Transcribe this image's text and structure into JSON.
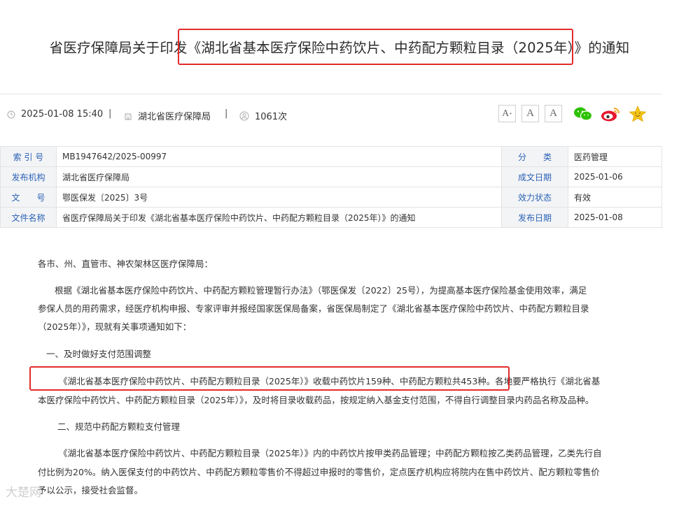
{
  "title": "省医疗保障局关于印发《湖北省基本医疗保险中药饮片、中药配方颗粒目录（2025年）》的通知",
  "meta": {
    "datetime": "2025-01-08 15:40",
    "publisher": "湖北省医疗保障局",
    "views": "1061次",
    "separator": "|"
  },
  "font_buttons": [
    "A+",
    "A",
    "A-"
  ],
  "social_icons": [
    "wechat-icon",
    "weibo-icon",
    "favorite-star-icon"
  ],
  "colors": {
    "label_blue": "#2b62b5",
    "highlight_red": "#e32b2b",
    "wechat": "#2dc100",
    "weibo": "#e6162d",
    "star": "#f5c518"
  },
  "info_table": [
    {
      "l1": "索 引 号",
      "v1": "MB1947642/2025-00997",
      "l2": "分　　类",
      "v2": "医药管理"
    },
    {
      "l1": "发布机构",
      "v1": "湖北省医疗保障局",
      "l2": "成文日期",
      "v2": "2025-01-06"
    },
    {
      "l1": "文　　号",
      "v1": "鄂医保发〔2025〕3号",
      "l2": "效力状态",
      "v2": "有效"
    },
    {
      "l1": "文件名称",
      "v1": "省医疗保障局关于印发《湖北省基本医疗保险中药饮片、中药配方颗粒目录（2025年）》的通知",
      "l2": "发布日期",
      "v2": "2025-01-08"
    }
  ],
  "body": {
    "salutation": "各市、州、直管市、神农架林区医疗保障局：",
    "para1": [
      "根据《湖北省基本医疗保险中药饮片、中药配方颗粒管理暂行办法》（鄂医保发〔2022〕25号），为提高基本医疗保险基金使用效率，满足",
      "参保人员的用药需求，经医疗机构申报、专家评审并报经国家医保局备案，省医保局制定了《湖北省基本医疗保险中药饮片、中药配方颗粒目录",
      "（2025年）》，现就有关事项通知如下："
    ],
    "heading1": "一、及时做好支付范围调整",
    "para2": [
      "《湖北省基本医疗保险中药饮片、中药配方颗粒目录（2025年）》收载中药饮片159种、中药配方颗粒共453种。各地要严格执行《湖北省基",
      "本医疗保险中药饮片、中药配方颗粒目录（2025年）》，及时将目录收载药品，按规定纳入基金支付范围，不得自行调整目录内药品名称及品种。"
    ],
    "heading2": "二、规范中药配方颗粒支付管理",
    "para3": [
      "《湖北省基本医疗保险中药饮片、中药配方颗粒目录（2025年）》内的中药饮片按甲类药品管理；中药配方颗粒按乙类药品管理，乙类先行自",
      "付比例为20%。纳入医保支付的中药饮片、中药配方颗粒零售价不得超过申报时的零售价，定点医疗机构应将院内在售中药饮片、配方颗粒零售价",
      "予以公示，接受社会监督。"
    ]
  },
  "watermark": "大楚网"
}
